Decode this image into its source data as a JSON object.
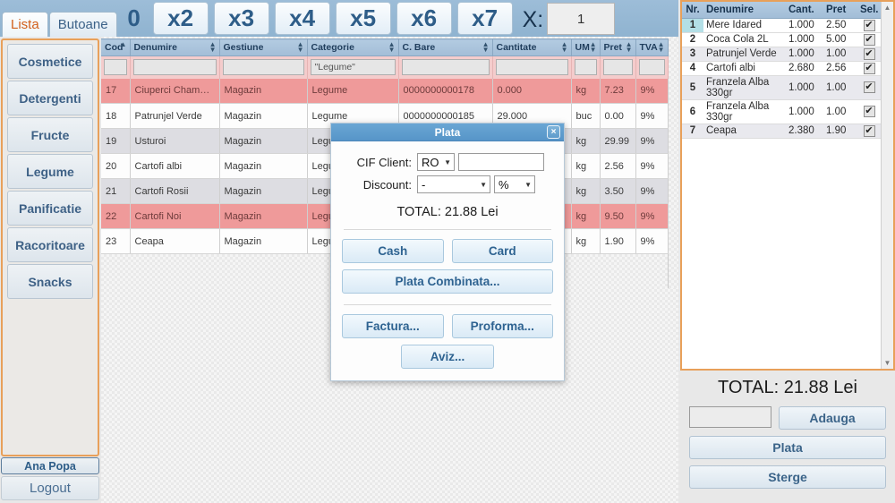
{
  "toolbar": {
    "tabs": [
      {
        "label": "Lista",
        "active": true
      },
      {
        "label": "Butoane",
        "active": false
      }
    ],
    "multipliers": [
      "0",
      "x2",
      "x3",
      "x4",
      "x5",
      "x6",
      "x7"
    ],
    "x_label": "X:",
    "x_value": "1"
  },
  "sidebar": {
    "categories": [
      {
        "label": "Cosmetice"
      },
      {
        "label": "Detergenti"
      },
      {
        "label": "Fructe"
      },
      {
        "label": "Legume"
      },
      {
        "label": "Panificatie"
      },
      {
        "label": "Racoritoare"
      },
      {
        "label": "Snacks"
      }
    ],
    "user": "Ana Popa",
    "logout": "Logout"
  },
  "grid": {
    "columns": [
      {
        "label": "Cod",
        "sort": "asc"
      },
      {
        "label": "Denumire",
        "sort": "both"
      },
      {
        "label": "Gestiune",
        "sort": "both"
      },
      {
        "label": "Categorie",
        "sort": "both"
      },
      {
        "label": "C. Bare",
        "sort": "both"
      },
      {
        "label": "Cantitate",
        "sort": "both"
      },
      {
        "label": "UM",
        "sort": "both"
      },
      {
        "label": "Pret",
        "sort": "both"
      },
      {
        "label": "TVA",
        "sort": "both"
      }
    ],
    "filters": [
      "",
      "",
      "",
      "\"Legume\"",
      "",
      "",
      "",
      "",
      ""
    ],
    "rows": [
      {
        "style": "pink",
        "cells": [
          "17",
          "Ciuperci Champignon",
          "Magazin",
          "Legume",
          "0000000000178",
          "0.000",
          "kg",
          "7.23",
          "9%"
        ]
      },
      {
        "style": "white",
        "cells": [
          "18",
          "Patrunjel Verde",
          "Magazin",
          "Legume",
          "0000000000185",
          "29.000",
          "buc",
          "0.00",
          "9%"
        ]
      },
      {
        "style": "grey",
        "cells": [
          "19",
          "Usturoi",
          "Magazin",
          "Legume",
          "",
          "",
          "kg",
          "29.99",
          "9%"
        ]
      },
      {
        "style": "white",
        "cells": [
          "20",
          "Cartofi albi",
          "Magazin",
          "Legume",
          "",
          "",
          "kg",
          "2.56",
          "9%"
        ]
      },
      {
        "style": "grey",
        "cells": [
          "21",
          "Cartofi Rosii",
          "Magazin",
          "Legume",
          "",
          "",
          "kg",
          "3.50",
          "9%"
        ]
      },
      {
        "style": "pink",
        "cells": [
          "22",
          "Cartofi Noi",
          "Magazin",
          "Legume",
          "",
          "",
          "kg",
          "9.50",
          "9%"
        ]
      },
      {
        "style": "white",
        "cells": [
          "23",
          "Ceapa",
          "Magazin",
          "Legume",
          "",
          "",
          "kg",
          "1.90",
          "9%"
        ]
      }
    ]
  },
  "modal": {
    "title": "Plata",
    "close_icon": "×",
    "cif_label": "CIF Client:",
    "cif_prefix": "RO",
    "cif_value": "",
    "discount_label": "Discount:",
    "discount_value": "-",
    "discount_unit": "%",
    "total": "TOTAL: 21.88 Lei",
    "buttons": {
      "cash": "Cash",
      "card": "Card",
      "combined": "Plata Combinata...",
      "factura": "Factura...",
      "proforma": "Proforma...",
      "aviz": "Aviz..."
    }
  },
  "cart": {
    "columns": [
      "Nr.",
      "Denumire",
      "Cant.",
      "Pret",
      "Sel."
    ],
    "check_glyph": "✔",
    "scroll_up": "▲",
    "scroll_down": "▼",
    "rows": [
      {
        "nr": "1",
        "name": "Mere Idared",
        "cant": "1.000",
        "pret": "2.50",
        "sel": true,
        "selected": true,
        "style": "white"
      },
      {
        "nr": "2",
        "name": "Coca Cola 2L",
        "cant": "1.000",
        "pret": "5.00",
        "sel": true,
        "selected": false,
        "style": "white"
      },
      {
        "nr": "3",
        "name": "Patrunjel Verde",
        "cant": "1.000",
        "pret": "1.00",
        "sel": true,
        "selected": false,
        "style": "grey"
      },
      {
        "nr": "4",
        "name": "Cartofi albi",
        "cant": "2.680",
        "pret": "2.56",
        "sel": true,
        "selected": false,
        "style": "white"
      },
      {
        "nr": "5",
        "name": "Franzela Alba 330gr",
        "cant": "1.000",
        "pret": "1.00",
        "sel": true,
        "selected": false,
        "style": "grey"
      },
      {
        "nr": "6",
        "name": "Franzela Alba 330gr",
        "cant": "1.000",
        "pret": "1.00",
        "sel": true,
        "selected": false,
        "style": "white"
      },
      {
        "nr": "7",
        "name": "Ceapa",
        "cant": "2.380",
        "pret": "1.90",
        "sel": true,
        "selected": false,
        "style": "grey"
      }
    ]
  },
  "actions": {
    "total": "TOTAL: 21.88 Lei",
    "qty_value": "",
    "add": "Adauga",
    "pay": "Plata",
    "delete": "Sterge"
  },
  "colors": {
    "accent_orange": "#e8a05a",
    "header_blue": "#a2bdd7",
    "row_pink": "#ef9a9a",
    "filter_pink": "#f4cccc",
    "selected_cyan": "#b3dfe6",
    "title_blue": "#5795c8",
    "text_blue": "#2e6391"
  }
}
